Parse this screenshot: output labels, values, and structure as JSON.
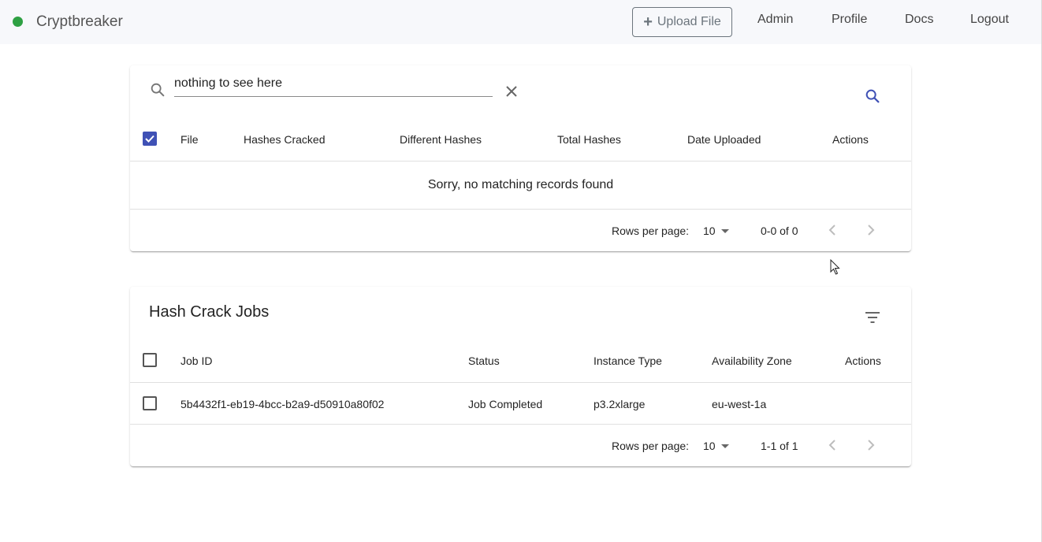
{
  "nav": {
    "brand": "Cryptbreaker",
    "upload_label": "Upload File",
    "links": [
      "Admin",
      "Profile",
      "Docs",
      "Logout"
    ],
    "status_color": "#2ea043"
  },
  "files_table": {
    "search_value": "nothing to see here",
    "columns": [
      "File",
      "Hashes Cracked",
      "Different Hashes",
      "Total Hashes",
      "Date Uploaded",
      "Actions"
    ],
    "empty_message": "Sorry, no matching records found",
    "rows_per_page_label": "Rows per page:",
    "rows_per_page": "10",
    "range": "0-0 of 0"
  },
  "jobs_table": {
    "title": "Hash Crack Jobs",
    "columns": [
      "Job ID",
      "Status",
      "Instance Type",
      "Availability Zone",
      "Actions"
    ],
    "rows": [
      {
        "job_id": "5b4432f1-eb19-4bcc-b2a9-d50910a80f02",
        "status": "Job Completed",
        "instance_type": "p3.2xlarge",
        "zone": "eu-west-1a"
      }
    ],
    "rows_per_page_label": "Rows per page:",
    "rows_per_page": "10",
    "range": "1-1 of 1"
  },
  "colors": {
    "accent": "#3f51b5"
  }
}
